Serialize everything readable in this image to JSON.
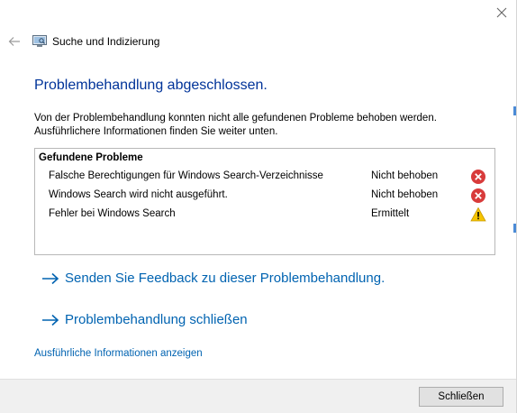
{
  "window": {
    "title": "Suche und Indizierung"
  },
  "main": {
    "title": "Problembehandlung abgeschlossen.",
    "description_line1": "Von der Problembehandlung konnten nicht alle gefundenen Probleme behoben werden.",
    "description_line2": "Ausführlichere Informationen finden Sie weiter unten."
  },
  "problems": {
    "heading": "Gefundene Probleme",
    "items": [
      {
        "text": "Falsche Berechtigungen für Windows Search-Verzeichnisse",
        "status": "Nicht behoben",
        "icon": "error-icon"
      },
      {
        "text": "Windows Search wird nicht ausgeführt.",
        "status": "Nicht behoben",
        "icon": "error-icon"
      },
      {
        "text": "Fehler bei Windows Search",
        "status": "Ermittelt",
        "icon": "warning-icon"
      }
    ]
  },
  "links": {
    "feedback": "Senden Sie Feedback zu dieser Problembehandlung.",
    "close_troubleshooter": "Problembehandlung schließen",
    "details": "Ausführliche Informationen anzeigen"
  },
  "footer": {
    "close_label": "Schließen"
  },
  "colors": {
    "title_blue": "#003399",
    "link_blue": "#0063b1",
    "error_red": "#d83b3b",
    "warning_yellow": "#f5c400"
  }
}
